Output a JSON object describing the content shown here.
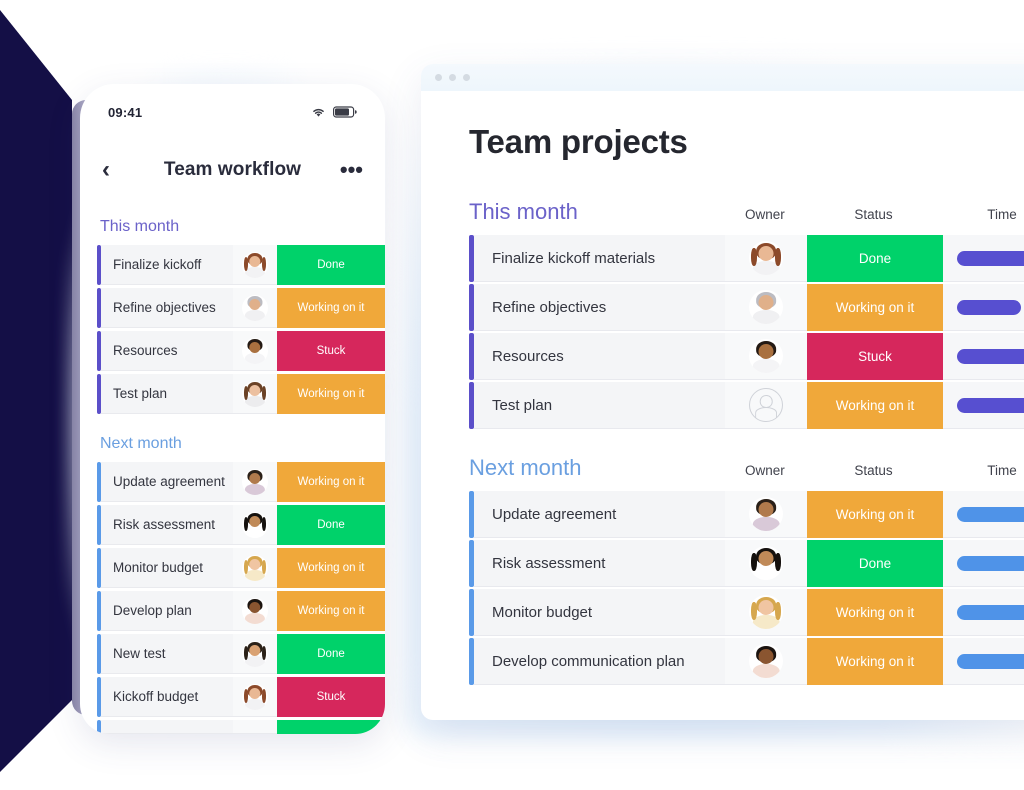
{
  "colors": {
    "navy_wedge": "#140f46",
    "status_done": "#00d26a",
    "status_working": "#f0a83a",
    "status_stuck": "#d6275c",
    "accent_purple": "#5b4fc9",
    "accent_blue": "#5a9ae8",
    "timeline_purple": "#574fd0",
    "timeline_blue": "#4f93e8",
    "section_purple": "#6b62c9",
    "section_blue": "#6a9fe0"
  },
  "phone": {
    "status_bar": {
      "time": "09:41",
      "wifi_icon": "wifi-icon",
      "battery_icon": "battery-icon"
    },
    "nav": {
      "back_icon": "‹",
      "title": "Team workflow",
      "more_icon": "•••"
    },
    "sections": [
      {
        "title": "This month",
        "title_color": "purple",
        "accent": "purple",
        "rows": [
          {
            "name": "Finalize kickoff",
            "status": "Done",
            "status_kind": "done",
            "avatar": "woman-auburn"
          },
          {
            "name": "Refine objectives",
            "status": "Working on it",
            "status_kind": "working",
            "avatar": "man-bald-beard"
          },
          {
            "name": "Resources",
            "status": "Stuck",
            "status_kind": "stuck",
            "avatar": "man-dark-beard"
          },
          {
            "name": "Test plan",
            "status": "Working on it",
            "status_kind": "working",
            "avatar": "woman-brown"
          }
        ]
      },
      {
        "title": "Next month",
        "title_color": "blue",
        "accent": "blue",
        "rows": [
          {
            "name": "Update agreement",
            "status": "Working on it",
            "status_kind": "working",
            "avatar": "man-smiling"
          },
          {
            "name": "Risk assessment",
            "status": "Done",
            "status_kind": "done",
            "avatar": "woman-black-hair"
          },
          {
            "name": "Monitor budget",
            "status": "Working on it",
            "status_kind": "working",
            "avatar": "woman-blonde"
          },
          {
            "name": "Develop plan",
            "status": "Working on it",
            "status_kind": "working",
            "avatar": "man-dark-skin"
          },
          {
            "name": "New test",
            "status": "Done",
            "status_kind": "done",
            "avatar": "woman-short-hair"
          },
          {
            "name": "Kickoff budget",
            "status": "Stuck",
            "status_kind": "stuck",
            "avatar": "woman-auburn"
          }
        ]
      }
    ]
  },
  "desktop": {
    "window_dots": [
      "dot-1",
      "dot-2",
      "dot-3"
    ],
    "title": "Team projects",
    "columns": {
      "owner": "Owner",
      "status": "Status",
      "time": "Time"
    },
    "sections": [
      {
        "title": "This month",
        "title_color": "purple",
        "accent": "purple",
        "timeline_color": "purple",
        "rows": [
          {
            "name": "Finalize kickoff materials",
            "status": "Done",
            "status_kind": "done",
            "avatar": "woman-auburn",
            "time_pct": 78
          },
          {
            "name": "Refine objectives",
            "status": "Working on it",
            "status_kind": "working",
            "avatar": "man-bald-beard",
            "time_pct": 62
          },
          {
            "name": "Resources",
            "status": "Stuck",
            "status_kind": "stuck",
            "avatar": "man-dark-beard",
            "time_pct": 78
          },
          {
            "name": "Test plan",
            "status": "Working on it",
            "status_kind": "working",
            "avatar": "empty",
            "time_pct": 78
          }
        ]
      },
      {
        "title": "Next month",
        "title_color": "blue",
        "accent": "blue",
        "timeline_color": "blue",
        "rows": [
          {
            "name": "Update agreement",
            "status": "Working on it",
            "status_kind": "working",
            "avatar": "man-smiling",
            "time_pct": 78
          },
          {
            "name": "Risk assessment",
            "status": "Done",
            "status_kind": "done",
            "avatar": "woman-black-hair",
            "time_pct": 70
          },
          {
            "name": "Monitor budget",
            "status": "Working on it",
            "status_kind": "working",
            "avatar": "woman-blonde",
            "time_pct": 78
          },
          {
            "name": "Develop communication plan",
            "status": "Working on it",
            "status_kind": "working",
            "avatar": "man-dark-skin",
            "time_pct": 78
          }
        ]
      }
    ]
  }
}
